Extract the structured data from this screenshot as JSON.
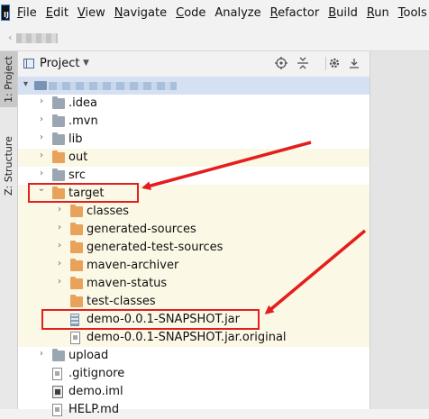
{
  "app": {
    "logo_text": "IJ"
  },
  "menu": [
    {
      "label": "File",
      "mnemonic": "F",
      "rest": "ile"
    },
    {
      "label": "Edit",
      "mnemonic": "E",
      "rest": "dit"
    },
    {
      "label": "View",
      "mnemonic": "V",
      "rest": "iew"
    },
    {
      "label": "Navigate",
      "mnemonic": "N",
      "rest": "avigate"
    },
    {
      "label": "Code",
      "mnemonic": "C",
      "rest": "ode"
    },
    {
      "label": "Analyze",
      "mnemonic": "",
      "rest": "Analyze"
    },
    {
      "label": "Refactor",
      "mnemonic": "R",
      "rest": "efactor"
    },
    {
      "label": "Build",
      "mnemonic": "B",
      "rest": "uild"
    },
    {
      "label": "Run",
      "mnemonic": "R",
      "rest": "un"
    },
    {
      "label": "Tools",
      "mnemonic": "T",
      "rest": "ools"
    }
  ],
  "tool_tabs": {
    "project": "1: Project",
    "structure": "Z: Structure"
  },
  "panel": {
    "title": "Project",
    "dropdown_icon": "triangle-down-icon"
  },
  "header_icons": [
    "locate-icon",
    "collapse-icon",
    "gear-icon",
    "hide-icon"
  ],
  "tree": [
    {
      "label": ".idea",
      "depth": 1,
      "expand": "collapsed",
      "icon": "folder-grey",
      "highlight": false
    },
    {
      "label": ".mvn",
      "depth": 1,
      "expand": "collapsed",
      "icon": "folder-grey",
      "highlight": false
    },
    {
      "label": "lib",
      "depth": 1,
      "expand": "collapsed",
      "icon": "folder-grey",
      "highlight": false
    },
    {
      "label": "out",
      "depth": 1,
      "expand": "collapsed",
      "icon": "folder-orange",
      "highlight": true
    },
    {
      "label": "src",
      "depth": 1,
      "expand": "collapsed",
      "icon": "folder-grey",
      "highlight": false
    },
    {
      "label": "target",
      "depth": 1,
      "expand": "expanded",
      "icon": "folder-orange",
      "highlight": true
    },
    {
      "label": "classes",
      "depth": 2,
      "expand": "collapsed",
      "icon": "folder-orange",
      "highlight": true
    },
    {
      "label": "generated-sources",
      "depth": 2,
      "expand": "collapsed",
      "icon": "folder-orange",
      "highlight": true
    },
    {
      "label": "generated-test-sources",
      "depth": 2,
      "expand": "collapsed",
      "icon": "folder-orange",
      "highlight": true
    },
    {
      "label": "maven-archiver",
      "depth": 2,
      "expand": "collapsed",
      "icon": "folder-orange",
      "highlight": true
    },
    {
      "label": "maven-status",
      "depth": 2,
      "expand": "collapsed",
      "icon": "folder-orange",
      "highlight": true
    },
    {
      "label": "test-classes",
      "depth": 2,
      "expand": "none",
      "icon": "folder-orange",
      "highlight": true
    },
    {
      "label": "demo-0.0.1-SNAPSHOT.jar",
      "depth": 2,
      "expand": "none",
      "icon": "jar",
      "highlight": true
    },
    {
      "label": "demo-0.0.1-SNAPSHOT.jar.original",
      "depth": 2,
      "expand": "none",
      "icon": "file",
      "highlight": true
    },
    {
      "label": "upload",
      "depth": 1,
      "expand": "collapsed",
      "icon": "folder-grey",
      "highlight": false
    },
    {
      "label": ".gitignore",
      "depth": 1,
      "expand": "none",
      "icon": "file",
      "highlight": false
    },
    {
      "label": "demo.iml",
      "depth": 1,
      "expand": "none",
      "icon": "iml",
      "highlight": false
    },
    {
      "label": "HELP.md",
      "depth": 1,
      "expand": "none",
      "icon": "file",
      "highlight": false
    }
  ],
  "colors": {
    "annotation": "#e41e1e",
    "selection": "#d5e1f3",
    "highlight_row": "#fbf8e6",
    "folder_orange": "#e8a25a"
  }
}
